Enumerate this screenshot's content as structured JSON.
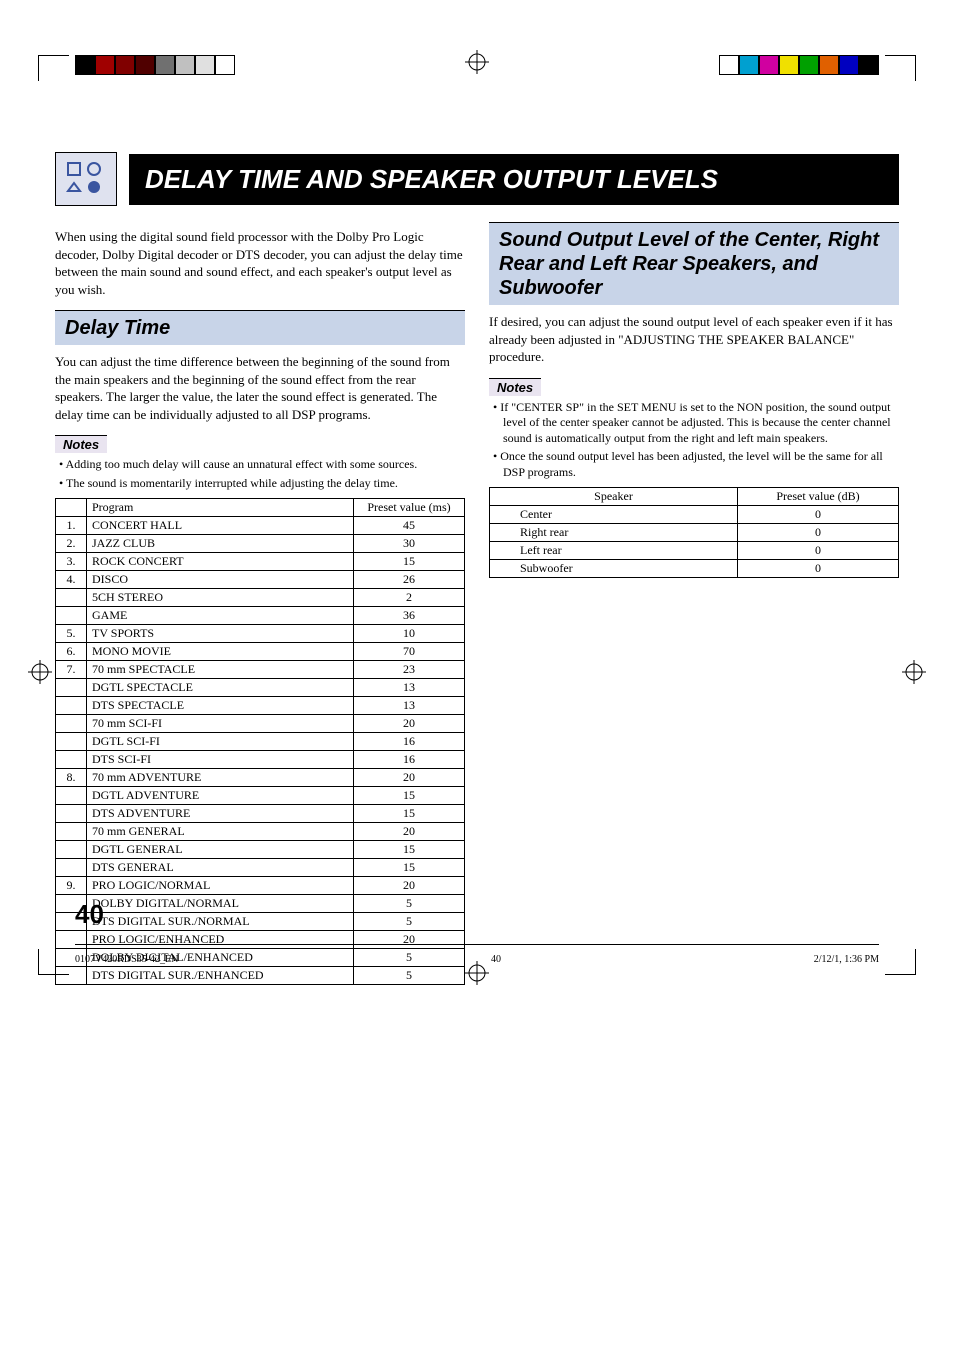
{
  "title": "DELAY TIME AND SPEAKER OUTPUT LEVELS",
  "intro_para": "When using the digital sound field processor with the Dolby Pro Logic decoder, Dolby Digital decoder or DTS decoder, you can adjust the delay time between the main sound and sound effect, and each speaker's output level as you wish.",
  "delay": {
    "heading": "Delay Time",
    "para": "You can adjust the time difference between the beginning of the sound from the main speakers and the beginning of the sound effect from the rear speakers. The larger the value, the later the sound effect is generated. The delay time can be individually adjusted to all DSP programs.",
    "notes_label": "Notes",
    "notes": [
      "Adding too much delay will cause an unnatural effect with some sources.",
      "The sound is momentarily interrupted while adjusting the delay time."
    ],
    "table_head": {
      "num": "",
      "prog": "Program",
      "val": "Preset value (ms)"
    },
    "rows": [
      {
        "num": "1.",
        "prog": "CONCERT HALL",
        "val": "45"
      },
      {
        "num": "2.",
        "prog": "JAZZ CLUB",
        "val": "30"
      },
      {
        "num": "3.",
        "prog": "ROCK CONCERT",
        "val": "15"
      },
      {
        "num": "4.",
        "prog": "DISCO",
        "val": "26"
      },
      {
        "num": "",
        "prog": "5CH STEREO",
        "val": "2"
      },
      {
        "num": "",
        "prog": "GAME",
        "val": "36"
      },
      {
        "num": "5.",
        "prog": "TV SPORTS",
        "val": "10"
      },
      {
        "num": "6.",
        "prog": "MONO MOVIE",
        "val": "70"
      },
      {
        "num": "7.",
        "prog": "70 mm SPECTACLE",
        "val": "23"
      },
      {
        "num": "",
        "prog": "DGTL SPECTACLE",
        "val": "13"
      },
      {
        "num": "",
        "prog": "DTS SPECTACLE",
        "val": "13"
      },
      {
        "num": "",
        "prog": "70 mm SCI-FI",
        "val": "20"
      },
      {
        "num": "",
        "prog": "DGTL SCI-FI",
        "val": "16"
      },
      {
        "num": "",
        "prog": "DTS SCI-FI",
        "val": "16"
      },
      {
        "num": "8.",
        "prog": "70 mm ADVENTURE",
        "val": "20"
      },
      {
        "num": "",
        "prog": "DGTL ADVENTURE",
        "val": "15"
      },
      {
        "num": "",
        "prog": "DTS ADVENTURE",
        "val": "15"
      },
      {
        "num": "",
        "prog": "70 mm GENERAL",
        "val": "20"
      },
      {
        "num": "",
        "prog": "DGTL GENERAL",
        "val": "15"
      },
      {
        "num": "",
        "prog": "DTS GENERAL",
        "val": "15"
      },
      {
        "num": "9.",
        "prog": "PRO LOGIC/NORMAL",
        "val": "20"
      },
      {
        "num": "",
        "prog": "DOLBY DIGITAL/NORMAL",
        "val": "5"
      },
      {
        "num": "",
        "prog": "DTS DIGITAL SUR./NORMAL",
        "val": "5"
      },
      {
        "num": "",
        "prog": "PRO LOGIC/ENHANCED",
        "val": "20"
      },
      {
        "num": "",
        "prog": "DOLBY DIGITAL/ENHANCED",
        "val": "5"
      },
      {
        "num": "",
        "prog": "DTS DIGITAL SUR./ENHANCED",
        "val": "5"
      }
    ]
  },
  "output": {
    "heading": "Sound Output Level of the Center, Right Rear and Left Rear Speakers, and Subwoofer",
    "para": "If desired, you can adjust the sound output level of each speaker even if it has already been adjusted in \"ADJUSTING THE SPEAKER BALANCE\" procedure.",
    "notes_label": "Notes",
    "notes": [
      "If \"CENTER SP\" in the SET MENU is set to the NON position, the sound output level of the center speaker cannot be adjusted. This is because the center channel sound is automatically output from the right and left main speakers.",
      "Once the sound output level has been adjusted, the level will be the same for all DSP programs."
    ],
    "table_head": {
      "spk": "Speaker",
      "val": "Preset value (dB)"
    },
    "rows": [
      {
        "spk": "Center",
        "val": "0"
      },
      {
        "spk": "Right rear",
        "val": "0"
      },
      {
        "spk": "Left rear",
        "val": "0"
      },
      {
        "spk": "Subwoofer",
        "val": "0"
      }
    ]
  },
  "page_number": "40",
  "footer": {
    "file": "0107V420RDS35-42_EN",
    "page": "40",
    "date": "2/12/1, 1:36 PM"
  },
  "reg_colors_left": [
    "#000000",
    "#a00000",
    "#800000",
    "#500000",
    "#707070",
    "#c0c0c0",
    "#e0e0e0",
    "#ffffff"
  ],
  "reg_colors_right": [
    "#ffffff",
    "#00a0d0",
    "#d000a0",
    "#f0e000",
    "#00a000",
    "#e06000",
    "#0000c0",
    "#000000"
  ]
}
